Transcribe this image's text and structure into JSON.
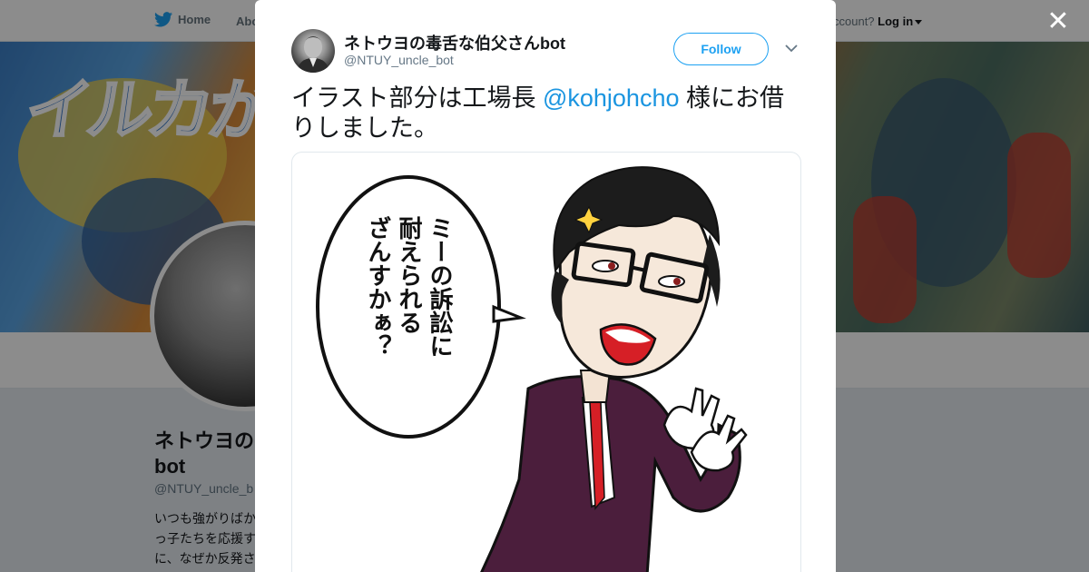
{
  "background_page": {
    "nav": {
      "home_label": "Home",
      "about_label": "Abo",
      "account_prompt": "ccount?",
      "login_label": "Log in"
    },
    "banner_title": "イルカがせ",
    "profile": {
      "name": "ネトウヨの\nbot",
      "handle": "@NTUY_uncle_b",
      "bio": "いつも強がりばか\nっ子たちを応援す\nに、なぜか反発さ\nんです。どうして"
    }
  },
  "tweet": {
    "author_name": "ネトウヨの毒舌な伯父さんbot",
    "author_handle": "@NTUY_uncle_bot",
    "follow_label": "Follow",
    "text_before": "イラスト部分は工場長 ",
    "mention": "@kohjohcho",
    "text_after": " 様にお借りしました。",
    "image": {
      "speech_line1": "ミーの訴訟に",
      "speech_line2": "耐えられる",
      "speech_line3": "ざんすかぁ？"
    }
  },
  "icons": [
    "twitter-bird-icon",
    "close-icon",
    "chevron-down-icon",
    "caret-down-icon"
  ],
  "colors": {
    "twitter_blue": "#1da1f2",
    "mention": "#1b95e0",
    "suit": "#4b1e3c",
    "tie": "#d61f26"
  }
}
